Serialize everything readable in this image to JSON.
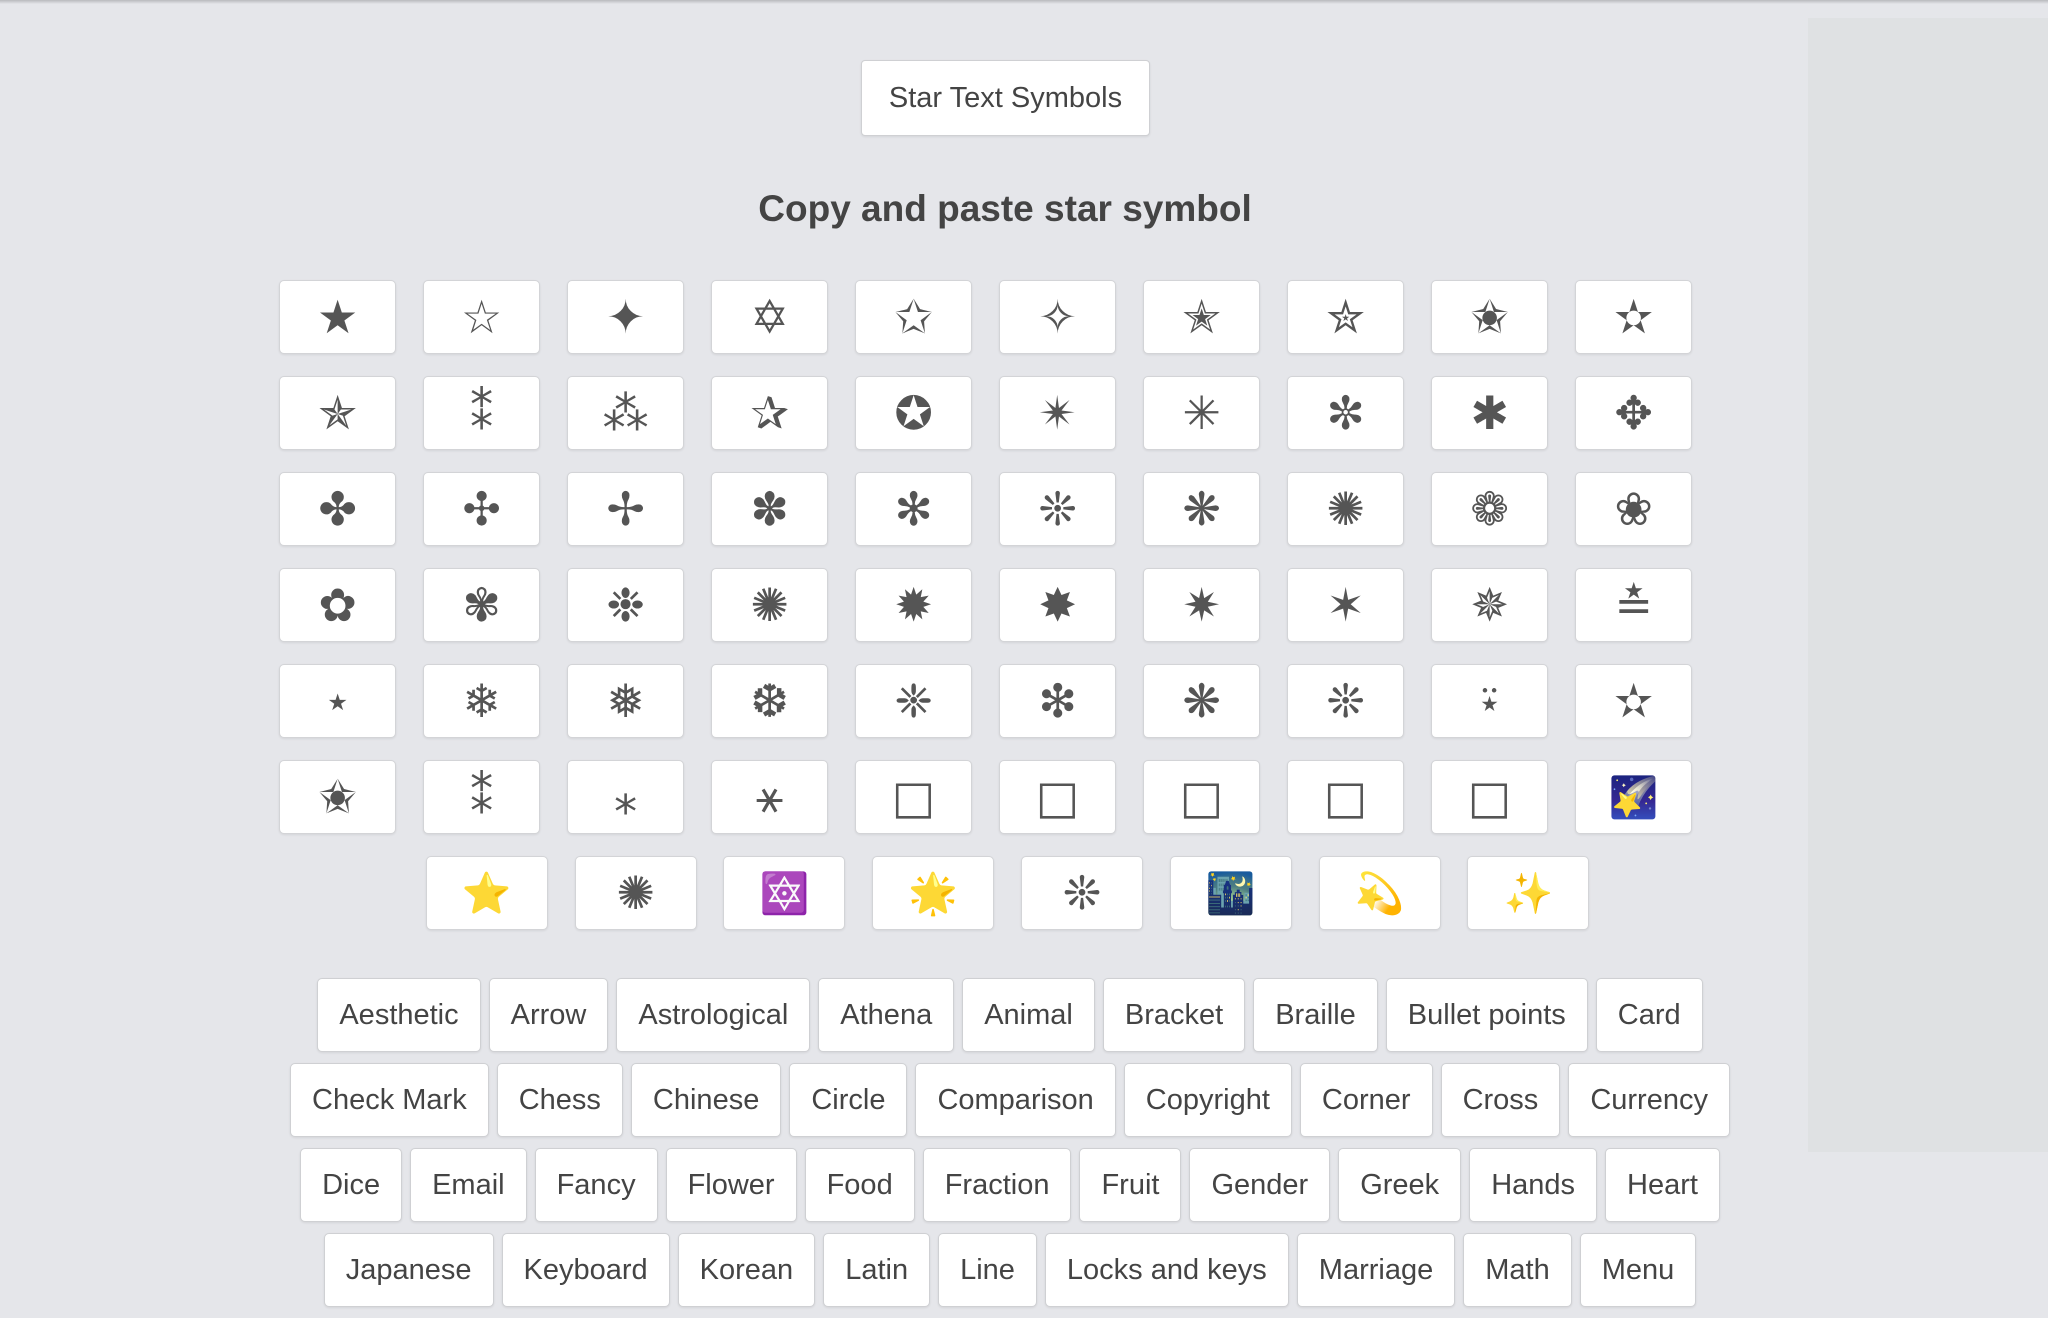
{
  "header": {
    "title_button": "Star Text Symbols",
    "heading": "Copy and paste star symbol"
  },
  "symbols": {
    "rows": [
      [
        "★",
        "☆",
        "✦",
        "✡",
        "✩",
        "✧",
        "✭",
        "✮",
        "✬",
        "✫"
      ],
      [
        "✯",
        "⁑",
        "⁂",
        "✰",
        "✪",
        "✴",
        "✳",
        "✼",
        "✱",
        "✥"
      ],
      [
        "✤",
        "✣",
        "✢",
        "✽",
        "✻",
        "❊",
        "❋",
        "✺",
        "❁",
        "❀"
      ],
      [
        "✿",
        "✾",
        "❉",
        "✺",
        "✹",
        "✸",
        "✷",
        "✶",
        "✵",
        "≛"
      ],
      [
        "⋆",
        "❄",
        "❅",
        "❆",
        "❈",
        "❇",
        "❋",
        "❊",
        "⍣",
        "✫"
      ],
      [
        "✬",
        "⁑",
        "⁎",
        "⚹",
        "□",
        "□",
        "□",
        "□",
        "□",
        "🌠"
      ],
      [
        "⭐",
        "✺",
        "🔯",
        "🌟",
        "❊",
        "🌃",
        "💫",
        "✨"
      ]
    ]
  },
  "categories": {
    "rows": [
      [
        "Aesthetic",
        "Arrow",
        "Astrological",
        "Athena",
        "Animal",
        "Bracket",
        "Braille",
        "Bullet points",
        "Card"
      ],
      [
        "Check Mark",
        "Chess",
        "Chinese",
        "Circle",
        "Comparison",
        "Copyright",
        "Corner",
        "Cross",
        "Currency"
      ],
      [
        "Dice",
        "Email",
        "Fancy",
        "Flower",
        "Food",
        "Fraction",
        "Fruit",
        "Gender",
        "Greek",
        "Hands",
        "Heart"
      ],
      [
        "Japanese",
        "Keyboard",
        "Korean",
        "Latin",
        "Line",
        "Locks and keys",
        "Marriage",
        "Math",
        "Menu"
      ]
    ]
  }
}
